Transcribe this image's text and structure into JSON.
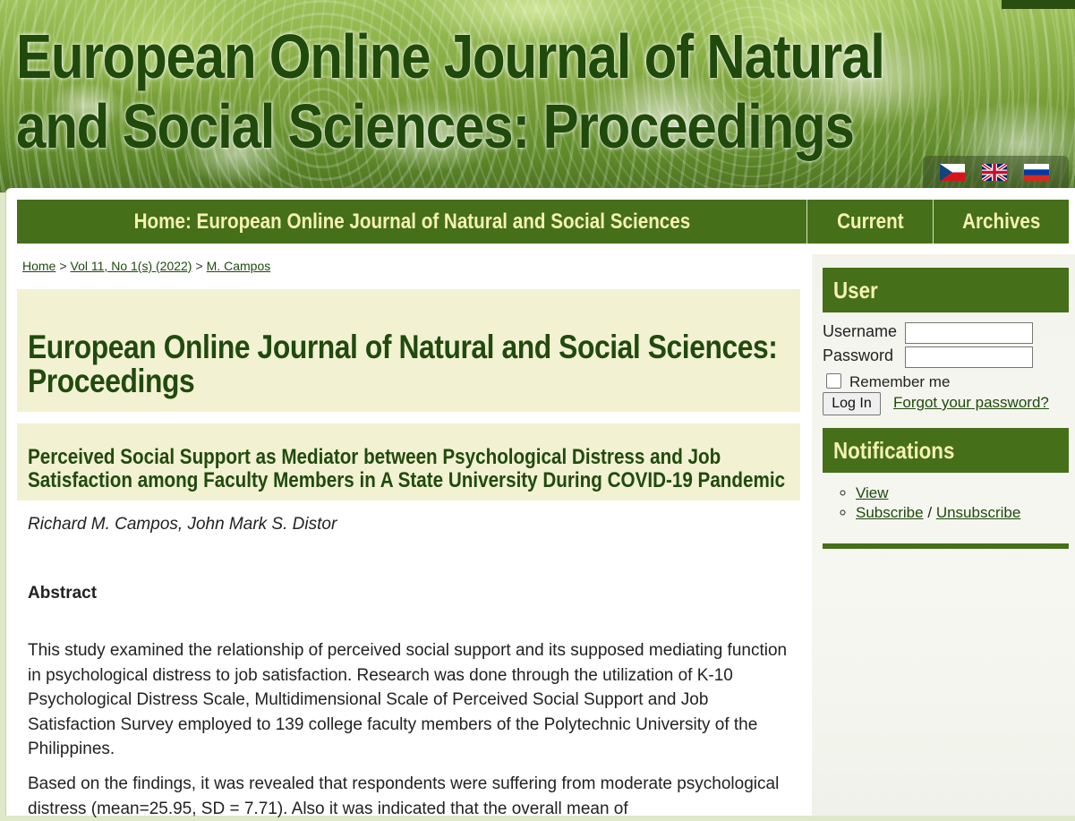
{
  "header": {
    "site_title": "European Online Journal of Natural and Social Sciences: Proceedings",
    "languages": [
      "Czech",
      "English",
      "Russian"
    ]
  },
  "nav": {
    "home": "Home: European Online Journal of Natural and Social Sciences",
    "current": "Current",
    "archives": "Archives"
  },
  "breadcrumb": {
    "home": "Home",
    "separator": ">",
    "issue": "Vol 11, No 1(s) (2022)",
    "author": "M. Campos"
  },
  "journal_title": "European Online Journal of Natural and Social Sciences: Proceedings",
  "article": {
    "title": "Perceived Social Support as Mediator between Psychological Distress and Job Satisfaction among Faculty Members in A State University During COVID-19 Pandemic",
    "authors": "Richard M. Campos, John Mark S. Distor",
    "abstract_heading": "Abstract",
    "abstract_p1": "This study examined the relationship of perceived social support and its supposed mediating function in psychological distress to job satisfaction. Research was done through the utilization of K-10 Psychological Distress Scale, Multidimensional Scale of Perceived Social Support and Job Satisfaction Survey employed to 139 college faculty members of the Polytechnic University of the Philippines.",
    "abstract_p2": "Based on the findings, it was revealed that respondents were suffering from moderate psychological distress (mean=25.95, SD = 7.71). Also it was indicated that the overall mean of"
  },
  "sidebar": {
    "user": {
      "heading": "User",
      "username_label": "Username",
      "password_label": "Password",
      "username_value": "",
      "password_value": "",
      "remember_label": "Remember me",
      "remember_checked": false,
      "login_button": "Log In",
      "forgot_link": "Forgot your password?"
    },
    "notifications": {
      "heading": "Notifications",
      "view": "View",
      "subscribe": "Subscribe",
      "slash": "/",
      "unsubscribe": "Unsubscribe"
    }
  },
  "colors": {
    "nav_green": "#456f18",
    "nav_text": "#f6f1b5",
    "title_green": "#214a0e",
    "box_cream": "#f2f2d2"
  }
}
